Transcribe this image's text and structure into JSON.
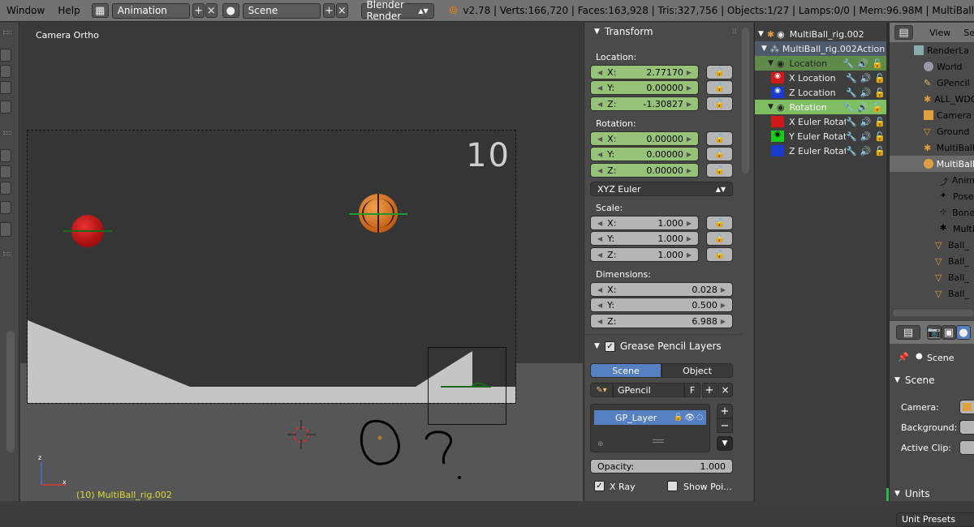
{
  "topbar": {
    "menus": [
      "Window",
      "Help"
    ],
    "layout_name": "Animation",
    "scene_name": "Scene",
    "render_engine": "Blender Render",
    "stats": "v2.78 | Verts:166,720 | Faces:163,928 | Tris:327,756 | Objects:1/27 | Lamps:0/0 | Mem:96.98M | MultiBall"
  },
  "viewport": {
    "view_label": "Camera Ortho",
    "frame_number": "10",
    "object_label": "(10) MultiBall_rig.002",
    "axis_z": "z",
    "axis_x": "x"
  },
  "properties": {
    "transform_header": "Transform",
    "location_label": "Location:",
    "location": [
      {
        "axis": "X:",
        "value": "2.77170"
      },
      {
        "axis": "Y:",
        "value": "0.00000"
      },
      {
        "axis": "Z:",
        "value": "-1.30827"
      }
    ],
    "rotation_label": "Rotation:",
    "rotation": [
      {
        "axis": "X:",
        "value": "0.00000"
      },
      {
        "axis": "Y:",
        "value": "0.00000"
      },
      {
        "axis": "Z:",
        "value": "0.00000"
      }
    ],
    "rotation_mode": "XYZ Euler",
    "scale_label": "Scale:",
    "scale": [
      {
        "axis": "X:",
        "value": "1.000"
      },
      {
        "axis": "Y:",
        "value": "1.000"
      },
      {
        "axis": "Z:",
        "value": "1.000"
      }
    ],
    "dimensions_label": "Dimensions:",
    "dimensions": [
      {
        "axis": "X:",
        "value": "0.028"
      },
      {
        "axis": "Y:",
        "value": "0.500"
      },
      {
        "axis": "Z:",
        "value": "6.988"
      }
    ],
    "gp_header": "Grease Pencil Layers",
    "gp_tab_scene": "Scene",
    "gp_tab_object": "Object",
    "gp_name": "GPencil",
    "gp_f": "F",
    "gp_layer": "GP_Layer",
    "opacity_label": "Opacity:",
    "opacity_value": "1.000",
    "xray_label": "X Ray",
    "showpoints_label": "Show Poi..."
  },
  "dopesheet": {
    "rows": [
      {
        "label": "MultiBall_rig.002"
      },
      {
        "label": "MultiBall_rig.002Action"
      },
      {
        "label": "Location"
      },
      {
        "label": "X Location"
      },
      {
        "label": "Z Location"
      },
      {
        "label": "Rotation"
      },
      {
        "label": "X Euler Rotation"
      },
      {
        "label": "Y Euler Rotation"
      },
      {
        "label": "Z Euler Rotation"
      }
    ]
  },
  "outliner": {
    "menu_view": "View",
    "menu_search": "Se",
    "items": [
      {
        "label": "RenderLa"
      },
      {
        "label": "World"
      },
      {
        "label": "GPencil"
      },
      {
        "label": "ALL_WDG"
      },
      {
        "label": "Camera"
      },
      {
        "label": "Ground"
      },
      {
        "label": "MultiBall"
      },
      {
        "label": "MultiBall"
      },
      {
        "label": "Anim"
      },
      {
        "label": "Pose"
      },
      {
        "label": "Bone"
      },
      {
        "label": "Multi"
      },
      {
        "label": "Ball_"
      },
      {
        "label": "Ball_"
      },
      {
        "label": "Ball_"
      },
      {
        "label": "Ball_"
      }
    ],
    "scene_label": "Scene",
    "scene_section": "Scene",
    "camera_label": "Camera:",
    "background_label": "Background:",
    "active_clip_label": "Active Clip:",
    "units_section": "Units",
    "unit_presets": "Unit Presets"
  },
  "colors": {
    "location_green": "#97c379",
    "active_blue": "#5680c2",
    "ball_red": "#cc1a1a",
    "ball_orange": "#d9781f"
  }
}
